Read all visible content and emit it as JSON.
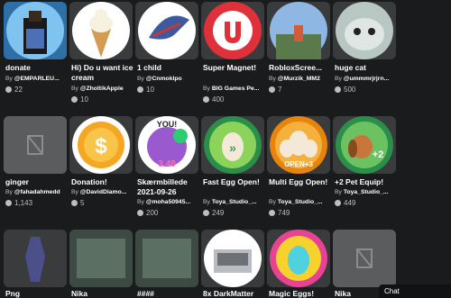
{
  "items": [
    {
      "name": "donate",
      "creator": "@EMPARLEU...",
      "count": "22",
      "icon": "avatar-thumbnail"
    },
    {
      "name": "Hi) Do u want ice cream",
      "creator": "@ZholtikApple",
      "count": "10",
      "icon": "ice-cream-thumbnail"
    },
    {
      "name": "1 child",
      "creator": "@Cnmoklpo",
      "count": "10",
      "icon": "wing-thumbnail"
    },
    {
      "name": "Super Magnet!",
      "creator": "BIG Games Pe...",
      "count": "400",
      "icon": "magnet-thumbnail"
    },
    {
      "name": "RobloxScree...",
      "creator": "@Murzik_MM2",
      "count": "7",
      "icon": "screenshot-thumbnail"
    },
    {
      "name": "huge cat",
      "creator": "@ummmrjrjrn...",
      "count": "500",
      "icon": "cat-thumbnail"
    },
    {
      "name": "ginger",
      "creator": "@fahadahmedd",
      "count": "1,143",
      "icon": "placeholder-thumbnail"
    },
    {
      "name": "Donation!",
      "creator": "@DavidDiamo...",
      "count": "5",
      "icon": "coin-thumbnail"
    },
    {
      "name": "Skærmbillede 2021-09-26",
      "creator": "@moha50945...",
      "count": "200",
      "icon": "screenshot-thumbnail"
    },
    {
      "name": "Fast Egg Open!",
      "creator": "Toya_Studio_...",
      "count": "249",
      "icon": "egg-thumbnail"
    },
    {
      "name": "Multi Egg Open!",
      "creator": "Toya_Studio_...",
      "count": "749",
      "icon": "egg-multi-thumbnail"
    },
    {
      "name": "+2 Pet Equip!",
      "creator": "Toya_Studio_...",
      "count": "449",
      "icon": "dog-thumbnail"
    },
    {
      "name": "Png",
      "creator": "",
      "count": "",
      "icon": "character-thumbnail"
    },
    {
      "name": "Nika",
      "creator": "",
      "count": "",
      "icon": "screenshot-thumbnail"
    },
    {
      "name": "####",
      "creator": "",
      "count": "",
      "icon": "screenshot-thumbnail"
    },
    {
      "name": "8x DarkMatter",
      "creator": "",
      "count": "",
      "icon": "machine-thumbnail"
    },
    {
      "name": "Magic Eggs!",
      "creator": "",
      "count": "",
      "icon": "rainbow-egg-thumbnail"
    },
    {
      "name": "Nika",
      "creator": "",
      "count": "",
      "icon": "placeholder-thumbnail"
    }
  ],
  "by_prefix": "By",
  "thumbnail_overlays": {
    "thumb_5_text": "3.48",
    "thumb_8_text": "YOU!",
    "thumb_10_text": "OPEN+3",
    "thumb_11_text": "+2"
  },
  "chat": {
    "label": "Chat"
  }
}
